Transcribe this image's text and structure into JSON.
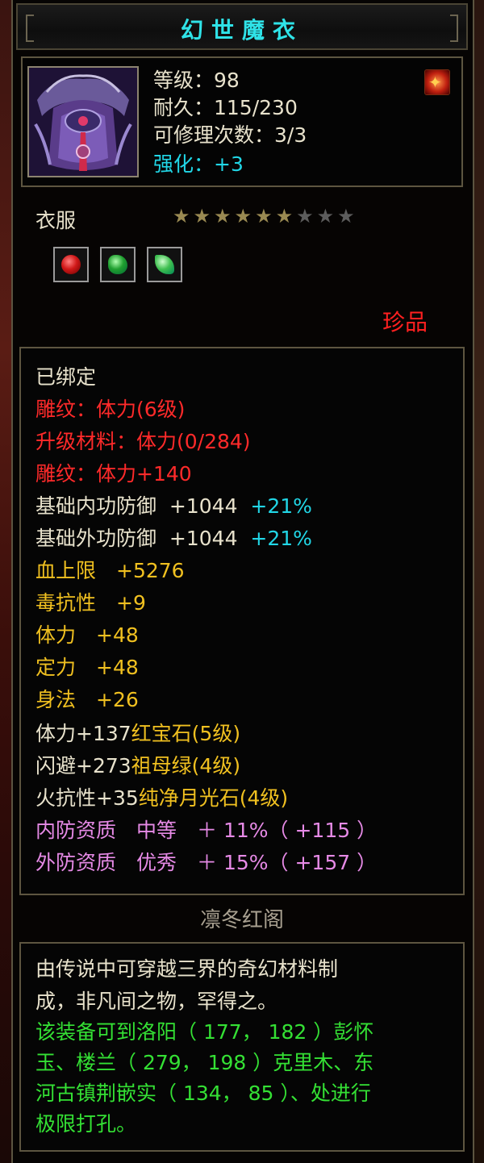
{
  "item": {
    "name": "幻世魔衣",
    "icon": "armor-robe-icon",
    "level_line": "等级：98",
    "durability_line": "耐久：115/230",
    "repair_line": "可修理次数：3/3",
    "enhance_label": "强化：",
    "enhance_value": "+3",
    "badge_icon": "fire-badge-icon",
    "type": "衣服",
    "stars": {
      "lit": 6,
      "total": 9
    },
    "gems": [
      {
        "icon": "ruby-gem-icon",
        "color": "#d01818"
      },
      {
        "icon": "emerald-gem-icon",
        "color": "#20a030"
      },
      {
        "icon": "jade-gem-icon",
        "color": "#40c050"
      }
    ],
    "rarity": "珍品"
  },
  "attributes": {
    "bound": "已绑定",
    "engrave_1": "雕纹：体力(6级)",
    "upgrade": "升级材料：体力(0/284)",
    "engrave_2": "雕纹：体力+140",
    "inner_def_label": "基础内功防御",
    "inner_def_value": "+1044",
    "inner_def_pct": "+21%",
    "outer_def_label": "基础外功防御",
    "outer_def_value": "+1044",
    "outer_def_pct": "+21%",
    "hp": "血上限　+5276",
    "poison": "毒抗性　+9",
    "stamina": "体力　+48",
    "focus": "定力　+48",
    "agility": "身法　+26",
    "gem_1_stat": "体力+137",
    "gem_1_name": "红宝石(5级)",
    "gem_2_stat": "闪避+273",
    "gem_2_name": "祖母绿(4级)",
    "gem_3_stat": "火抗性+35",
    "gem_3_name": "纯净月光石(4级)",
    "quality_1": "内防资质　中等　＋ 11%（ +115 ）",
    "quality_2": "外防资质　优秀　＋ 15%（ +157 ）"
  },
  "maker": "凛冬红阁",
  "description": {
    "line1": "由传说中可穿越三界的奇幻材料制",
    "line2": "成，非凡间之物，罕得之。",
    "line3": "该装备可到洛阳（ 177， 182 ）彭怀",
    "line4": "玉、楼兰（ 279， 198 ）克里木、东",
    "line5": "河古镇荆嵌实（ 134， 85 ）、处进行",
    "line6": "极限打孔。"
  },
  "colors": {
    "title": "#2fe3e8",
    "bound": "#e8e2cc",
    "engrave": "#ff2a2a",
    "stat": "#f0c020",
    "percent": "#21d6e6",
    "quality": "#e68ae6",
    "hint": "#34e034",
    "rarity": "#ff2020"
  }
}
